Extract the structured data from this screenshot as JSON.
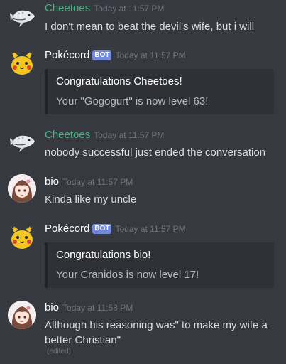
{
  "messages": [
    {
      "author": "Cheetoes",
      "timestamp": "Today at 11:57 PM",
      "text": "I don't mean to beat the devil's wife, but i will"
    },
    {
      "author": "Pokécord",
      "bot_tag": "BOT",
      "timestamp": "Today at 11:57 PM",
      "embed": {
        "title": "Congratulations Cheetoes!",
        "description": "Your \"Gogogurt\" is now level 63!"
      }
    },
    {
      "author": "Cheetoes",
      "timestamp": "Today at 11:57 PM",
      "text": "nobody successful just ended the conversation"
    },
    {
      "author": "bio",
      "timestamp": "Today at 11:57 PM",
      "text": "Kinda like my uncle"
    },
    {
      "author": "Pokécord",
      "bot_tag": "BOT",
      "timestamp": "Today at 11:57 PM",
      "embed": {
        "title": "Congratulations bio!",
        "description": "Your Cranidos is now level 17!"
      }
    },
    {
      "author": "bio",
      "timestamp": "Today at 11:58 PM",
      "text": "Although his reasoning was\" to make my wife a better Christian\"",
      "edited": "(edited)"
    }
  ],
  "colors": {
    "background": "#36393f",
    "cheetoes_name": "#43b581",
    "pokecord_name": "#ffffff",
    "bio_name": "#ffffff",
    "bot_badge": "#7289da",
    "embed_bg": "#2f3136",
    "timestamp": "#72767d"
  },
  "icons": {
    "cheetoes_avatar": "whale-shark-avatar",
    "pokecord_avatar": "pikachu-avatar",
    "bio_avatar": "anime-girl-avatar"
  }
}
